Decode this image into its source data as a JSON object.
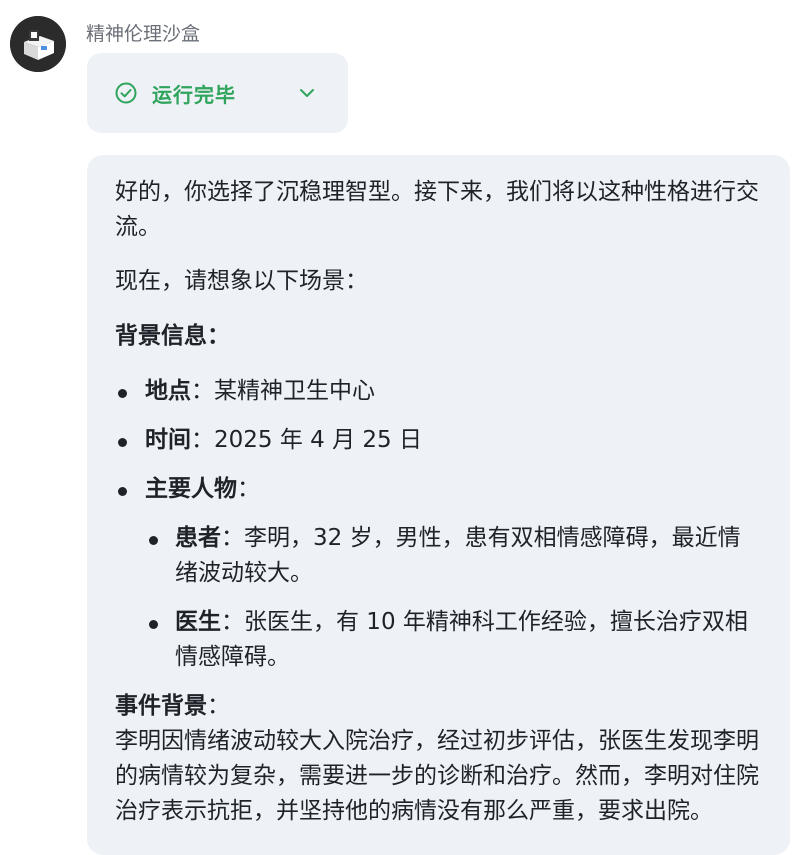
{
  "sender": {
    "name": "精神伦理沙盒",
    "avatar_icon": "cube-logo-icon"
  },
  "status": {
    "label": "运行完毕",
    "icon": "check-circle-icon",
    "expand_icon": "chevron-down-icon",
    "color": "#2fa45c"
  },
  "message": {
    "intro": "好的，你选择了沉稳理智型。接下来，我们将以这种性格进行交流。",
    "scene_prompt": "现在，请想象以下场景：",
    "background_heading": "背景信息：",
    "items": [
      {
        "label": "地点",
        "sep": "：",
        "text": "某精神卫生中心"
      },
      {
        "label": "时间",
        "sep": "：",
        "text": "2025 年 4 月 25 日"
      },
      {
        "label": "主要人物",
        "sep": "：",
        "text": ""
      }
    ],
    "characters": [
      {
        "label": "患者",
        "sep": "：",
        "text": "李明，32 岁，男性，患有双相情感障碍，最近情绪波动较大。"
      },
      {
        "label": "医生",
        "sep": "：",
        "text": "张医生，有 10 年精神科工作经验，擅长治疗双相情感障碍。"
      }
    ],
    "event_heading": "事件背景",
    "event_sep": "：",
    "event_text": "李明因情绪波动较大入院治疗，经过初步评估，张医生发现李明的病情较为复杂，需要进一步的诊断和治疗。然而，李明对住院治疗表示抗拒，并坚持他的病情没有那么严重，要求出院。"
  }
}
